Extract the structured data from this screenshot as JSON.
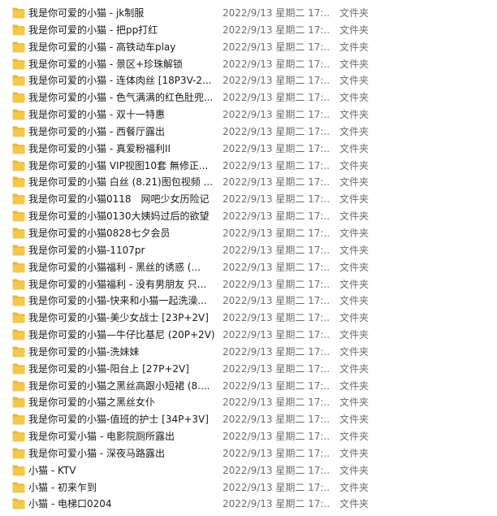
{
  "folder_color": "#F4C84A",
  "folder_tab_color": "#E6B43A",
  "icon": "folder-icon",
  "rows": [
    {
      "name": "我是你可爱的小猫 - jk制服",
      "date": "2022/9/13 星期二 17:...",
      "type": "文件夹"
    },
    {
      "name": "我是你可爱的小猫 - 把pp打红",
      "date": "2022/9/13 星期二 17:...",
      "type": "文件夹"
    },
    {
      "name": "我是你可爱的小猫 - 高铁动车play",
      "date": "2022/9/13 星期二 17:...",
      "type": "文件夹"
    },
    {
      "name": "我是你可爱的小猫 - 景区+珍珠解锁",
      "date": "2022/9/13 星期二 17:...",
      "type": "文件夹"
    },
    {
      "name": "我是你可爱的小猫 - 连体肉丝 [18P3V-2...",
      "date": "2022/9/13 星期二 17:...",
      "type": "文件夹"
    },
    {
      "name": "我是你可爱的小猫 - 色气满满的红色肚兜...",
      "date": "2022/9/13 星期二 17:...",
      "type": "文件夹"
    },
    {
      "name": "我是你可爱的小猫 - 双十一特惠",
      "date": "2022/9/13 星期二 17:...",
      "type": "文件夹"
    },
    {
      "name": "我是你可爱的小猫 - 西餐厅露出",
      "date": "2022/9/13 星期二 17:...",
      "type": "文件夹"
    },
    {
      "name": "我是你可爱的小猫 - 真爱粉福利II",
      "date": "2022/9/13 星期二 17:...",
      "type": "文件夹"
    },
    {
      "name": "我是你可爱的小猫 VIP视图10套 無修正...",
      "date": "2022/9/13 星期二 17:...",
      "type": "文件夹"
    },
    {
      "name": "我是你可爱的小猫 白丝 (8.21)图包视频 ...",
      "date": "2022/9/13 星期二 17:...",
      "type": "文件夹"
    },
    {
      "name": "我是你可爱的小猫0118　网吧少女历险记",
      "date": "2022/9/13 星期二 17:...",
      "type": "文件夹"
    },
    {
      "name": "我是你可爱的小猫0130大姨妈过后的欲望",
      "date": "2022/9/13 星期二 17:...",
      "type": "文件夹"
    },
    {
      "name": "我是你可爱的小猫0828七夕会员",
      "date": "2022/9/13 星期二 17:...",
      "type": "文件夹"
    },
    {
      "name": "我是你可爱的小猫-1107pr",
      "date": "2022/9/13 星期二 17:...",
      "type": "文件夹"
    },
    {
      "name": "我是你可爱的小猫福利 - 黑丝的诱惑 (...",
      "date": "2022/9/13 星期二 17:...",
      "type": "文件夹"
    },
    {
      "name": "我是你可爱的小猫福利 - 没有男朋友 只...",
      "date": "2022/9/13 星期二 17:...",
      "type": "文件夹"
    },
    {
      "name": "我是你可爱的小猫-快来和小猫一起洗澡...",
      "date": "2022/9/13 星期二 17:...",
      "type": "文件夹"
    },
    {
      "name": "我是你可爱的小猫-美少女战士 [23P+2V]",
      "date": "2022/9/13 星期二 17:...",
      "type": "文件夹"
    },
    {
      "name": "我是你可爱的小猫—牛仔比基尼 (20P+2V)",
      "date": "2022/9/13 星期二 17:...",
      "type": "文件夹"
    },
    {
      "name": "我是你可爱的小猫-洗妹妹",
      "date": "2022/9/13 星期二 17:...",
      "type": "文件夹"
    },
    {
      "name": "我是你可爱的小猫-阳台上 [27P+2V]",
      "date": "2022/9/13 星期二 17:...",
      "type": "文件夹"
    },
    {
      "name": "我是你可爱的小猫之黑丝高跟小短裙 (8....",
      "date": "2022/9/13 星期二 17:...",
      "type": "文件夹"
    },
    {
      "name": "我是你可爱的小猫之黑丝女仆",
      "date": "2022/9/13 星期二 17:...",
      "type": "文件夹"
    },
    {
      "name": "我是你可爱的小猫-值班的护士 [34P+3V]",
      "date": "2022/9/13 星期二 17:...",
      "type": "文件夹"
    },
    {
      "name": "我是你可爱小猫 - 电影院厕所露出",
      "date": "2022/9/13 星期二 17:...",
      "type": "文件夹"
    },
    {
      "name": "我是你可爱小猫 - 深夜马路露出",
      "date": "2022/9/13 星期二 17:...",
      "type": "文件夹"
    },
    {
      "name": "小猫 - KTV",
      "date": "2022/9/13 星期二 17:...",
      "type": "文件夹"
    },
    {
      "name": "小猫 - 初来乍到",
      "date": "2022/9/13 星期二 17:...",
      "type": "文件夹"
    },
    {
      "name": "小猫 - 电梯口0204",
      "date": "2022/9/13 星期二 17:...",
      "type": "文件夹"
    }
  ]
}
